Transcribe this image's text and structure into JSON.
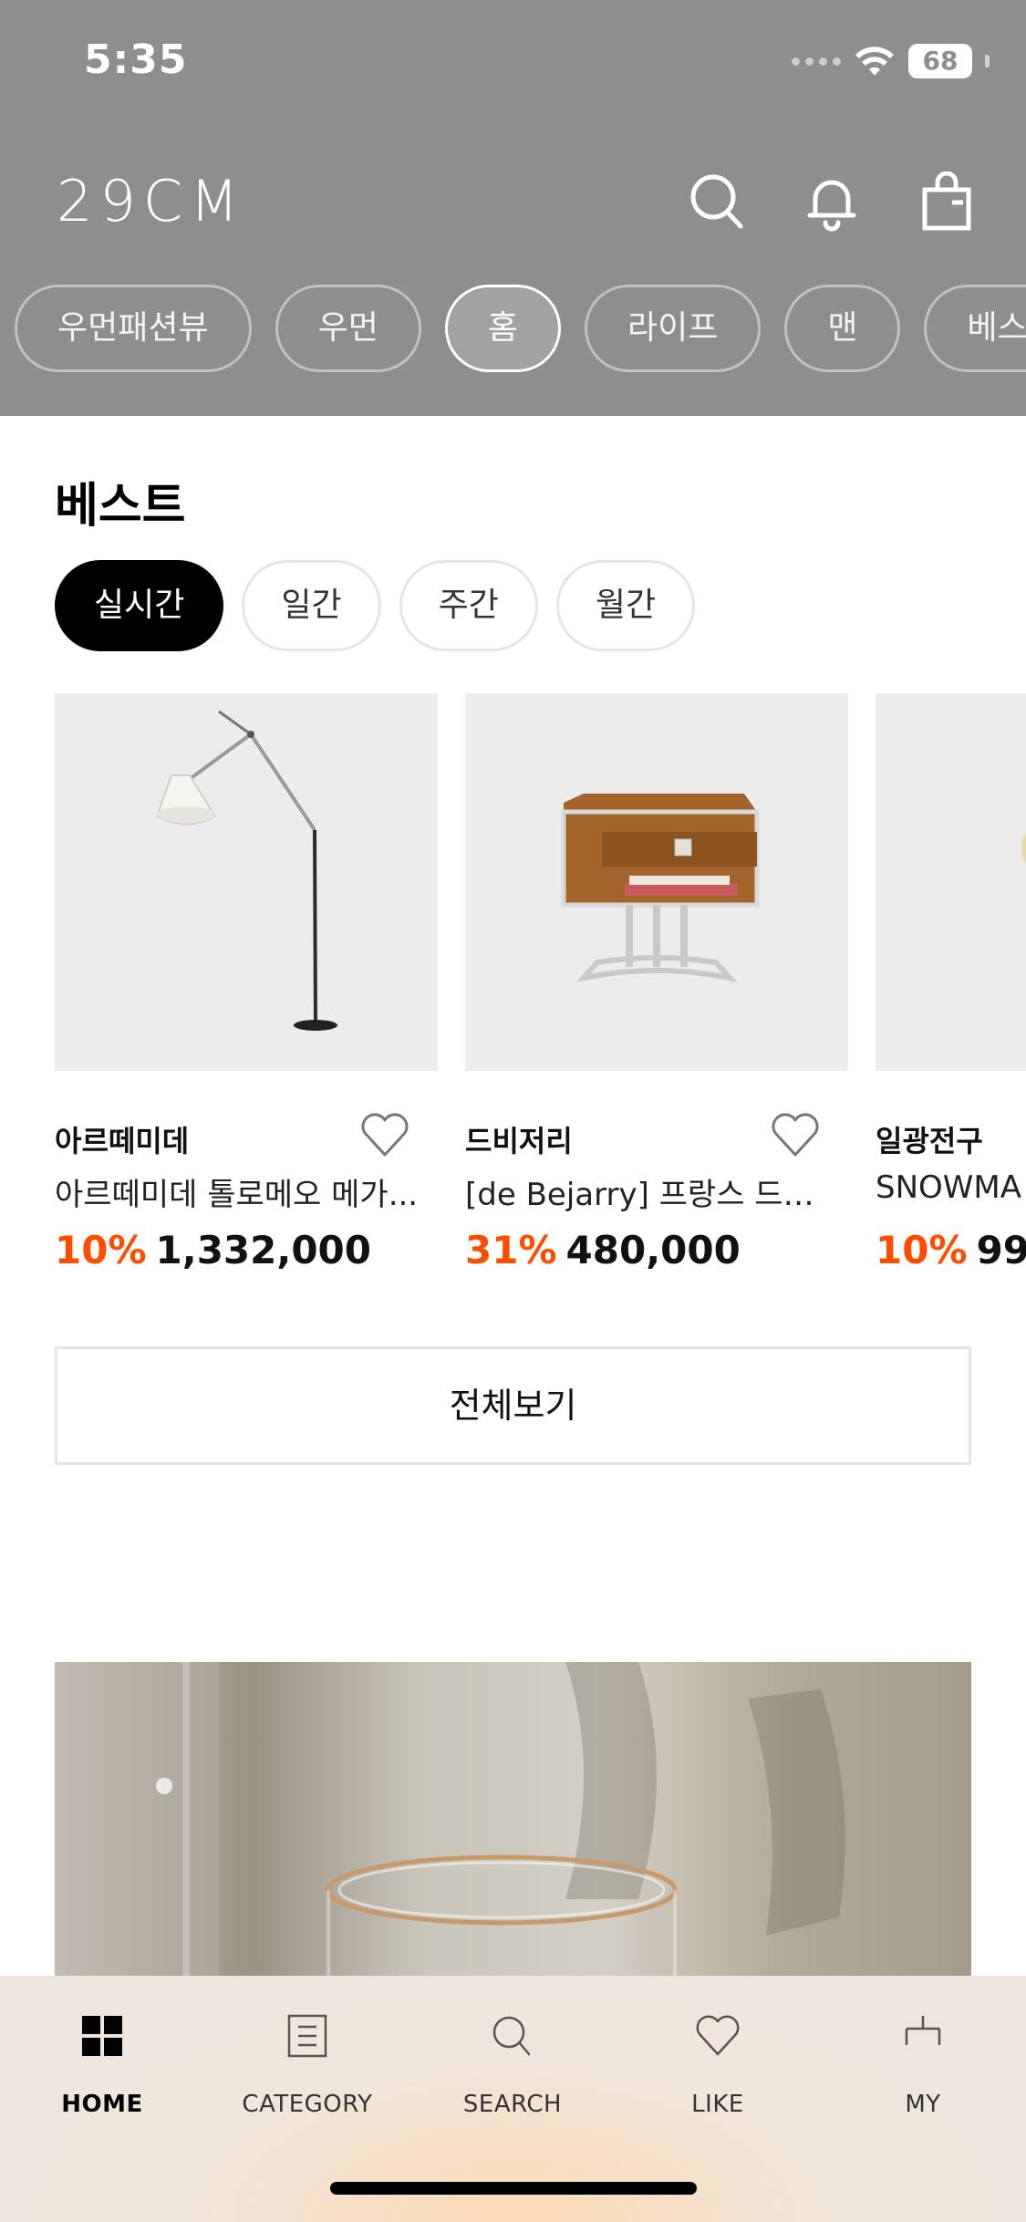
{
  "status_bar": {
    "time": "5:35",
    "battery": "68"
  },
  "header": {
    "logo": "29CM",
    "icons": [
      "search-icon",
      "bell-icon",
      "shopping-bag-icon"
    ],
    "categories": [
      {
        "label": "우먼패션뷰",
        "active": false
      },
      {
        "label": "우먼",
        "active": false
      },
      {
        "label": "홈",
        "active": true
      },
      {
        "label": "라이프",
        "active": false
      },
      {
        "label": "맨",
        "active": false
      },
      {
        "label": "베스",
        "active": false
      }
    ]
  },
  "best": {
    "title": "베스트",
    "tabs": [
      {
        "label": "실시간",
        "active": true
      },
      {
        "label": "일간",
        "active": false
      },
      {
        "label": "주간",
        "active": false
      },
      {
        "label": "월간",
        "active": false
      }
    ],
    "products": [
      {
        "brand": "아르떼미데",
        "name": "아르떼미데 톨로메오 메가...",
        "discount": "10%",
        "price": "1,332,000",
        "image": "floor-lamp"
      },
      {
        "brand": "드비저리",
        "name": "[de Bejarry] 프랑스 드비…",
        "discount": "31%",
        "price": "480,000",
        "image": "nightstand"
      },
      {
        "brand": "일광전구",
        "name": "SNOWMA",
        "discount": "10%",
        "price": "99,",
        "image": "light-bulb"
      }
    ],
    "view_all": "전체보기"
  },
  "bottom_nav": [
    {
      "label": "HOME",
      "icon": "home-grid-icon",
      "active": true
    },
    {
      "label": "CATEGORY",
      "icon": "category-list-icon",
      "active": false
    },
    {
      "label": "SEARCH",
      "icon": "search-icon",
      "active": false
    },
    {
      "label": "LIKE",
      "icon": "heart-icon",
      "active": false
    },
    {
      "label": "MY",
      "icon": "my-icon",
      "active": false
    }
  ],
  "colors": {
    "accent_discount": "#ff4d00",
    "header_overlay": "#8e8e8e"
  }
}
